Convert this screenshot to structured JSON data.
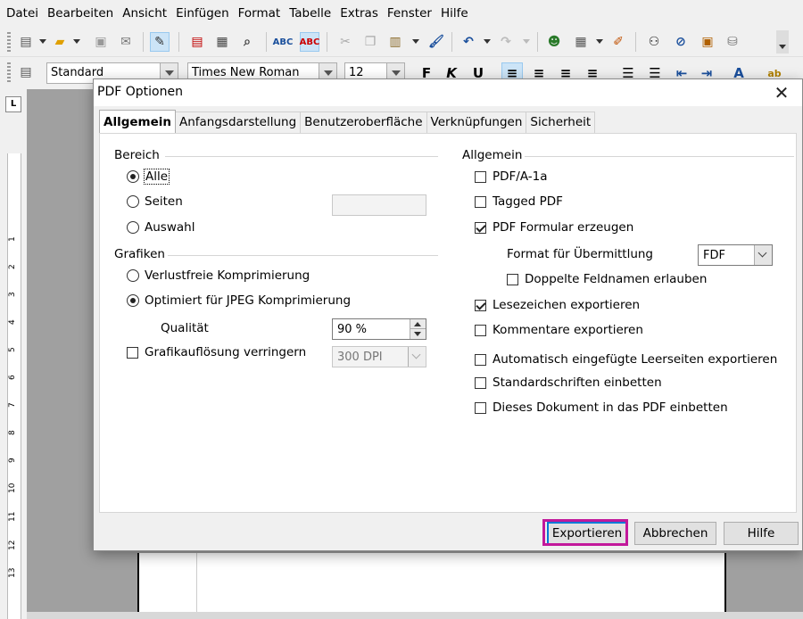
{
  "menubar": [
    "Datei",
    "Bearbeiten",
    "Ansicht",
    "Einfügen",
    "Format",
    "Tabelle",
    "Extras",
    "Fenster",
    "Hilfe"
  ],
  "toolbar2": {
    "style_value": "Standard",
    "font_value": "Times New Roman",
    "size_value": "12",
    "bold_label": "F",
    "italic_label": "K",
    "underline_label": "U"
  },
  "ruler_numbers": [
    "1",
    "2",
    "3",
    "4",
    "5",
    "6",
    "7",
    "8",
    "9",
    "10",
    "11",
    "12",
    "13"
  ],
  "dialog": {
    "title": "PDF Optionen",
    "close_glyph": "✕",
    "tabs": [
      "Allgemein",
      "Anfangsdarstellung",
      "Benutzeroberfläche",
      "Verknüpfungen",
      "Sicherheit"
    ],
    "bereich": {
      "title": "Bereich",
      "alle": "Alle",
      "seiten": "Seiten",
      "auswahl": "Auswahl",
      "seiten_value": ""
    },
    "grafiken": {
      "title": "Grafiken",
      "verlustfrei": "Verlustfreie Komprimierung",
      "jpeg": "Optimiert für JPEG Komprimierung",
      "qualitaet_label": "Qualität",
      "qualitaet_value": "90 %",
      "aufloesung_label": "Grafikauflösung verringern",
      "aufloesung_value": "300 DPI"
    },
    "allgemein": {
      "title": "Allgemein",
      "pdfa": "PDF/A-1a",
      "tagged": "Tagged PDF",
      "formular": "PDF Formular erzeugen",
      "format_label": "Format für Übermittlung",
      "format_value": "FDF",
      "doppelte": "Doppelte Feldnamen erlauben",
      "lesezeichen": "Lesezeichen exportieren",
      "kommentare": "Kommentare exportieren",
      "leerseiten": "Automatisch eingefügte Leerseiten exportieren",
      "schriften": "Standardschriften einbetten",
      "einbetten": "Dieses Dokument in das PDF einbetten"
    },
    "buttons": {
      "export": "Exportieren",
      "cancel": "Abbrechen",
      "help": "Hilfe"
    }
  },
  "colors": {
    "highlight": "#c2189b",
    "default_button_border": "#0078d7"
  }
}
